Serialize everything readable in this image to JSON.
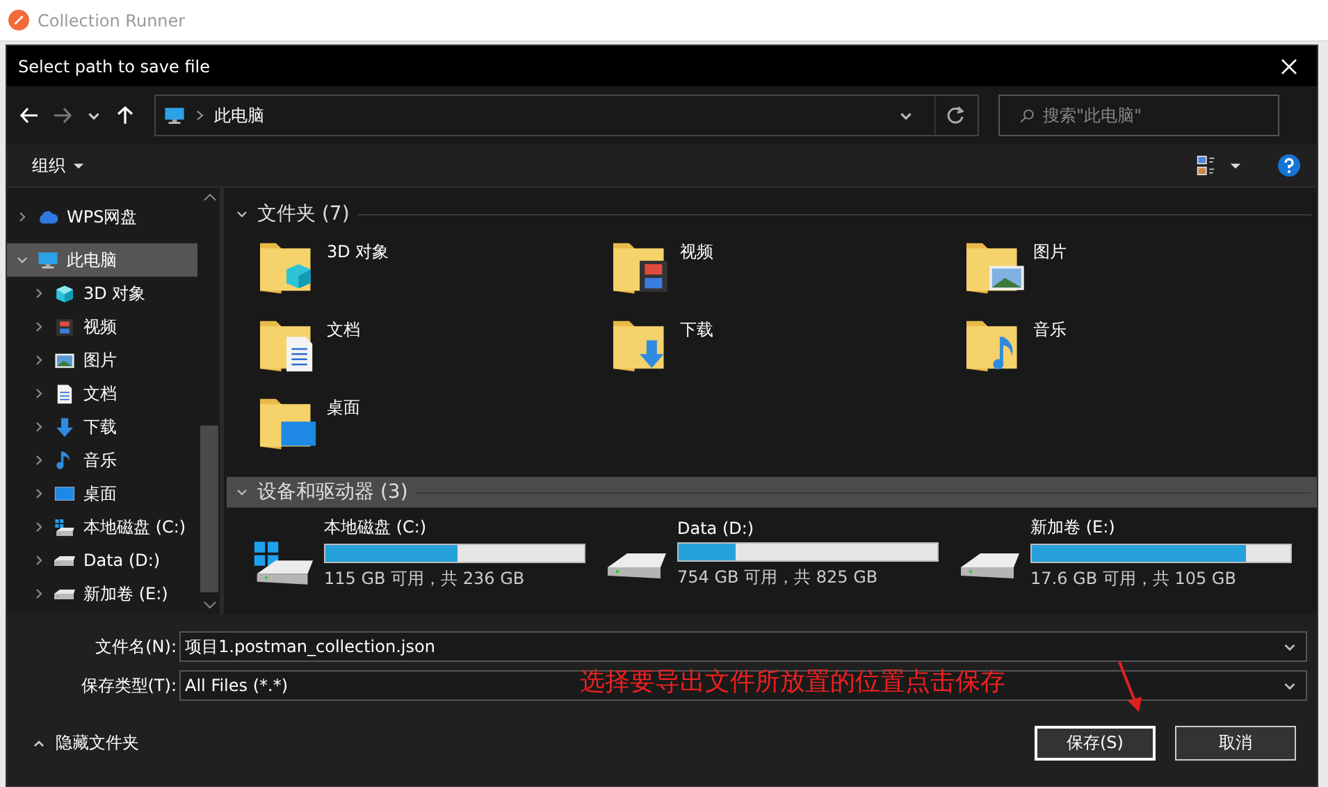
{
  "app": {
    "title": "Collection Runner"
  },
  "dialog": {
    "title": "Select path to save file",
    "address": {
      "crumb": "此电脑"
    },
    "search": {
      "placeholder": "搜索\"此电脑\""
    },
    "toolbar": {
      "organize": "组织"
    },
    "sidebar": {
      "items": [
        {
          "label": "WPS网盘",
          "kind": "cloud",
          "expanded": false,
          "selected": false
        },
        {
          "label": "此电脑",
          "kind": "pc",
          "expanded": true,
          "selected": true,
          "children": [
            {
              "label": "3D 对象",
              "kind": "cube",
              "expanded": false,
              "selected": false
            },
            {
              "label": "视频",
              "kind": "video",
              "expanded": false,
              "selected": false
            },
            {
              "label": "图片",
              "kind": "picture",
              "expanded": false,
              "selected": false
            },
            {
              "label": "文档",
              "kind": "document",
              "expanded": false,
              "selected": false
            },
            {
              "label": "下载",
              "kind": "download",
              "expanded": false,
              "selected": false
            },
            {
              "label": "音乐",
              "kind": "music",
              "expanded": false,
              "selected": false
            },
            {
              "label": "桌面",
              "kind": "desktop",
              "expanded": false,
              "selected": false
            },
            {
              "label": "本地磁盘 (C:)",
              "kind": "sysdrive",
              "expanded": false,
              "selected": false
            },
            {
              "label": "Data (D:)",
              "kind": "drive",
              "expanded": false,
              "selected": false
            },
            {
              "label": "新加卷 (E:)",
              "kind": "drive",
              "expanded": false,
              "selected": false
            }
          ]
        }
      ]
    },
    "folders": {
      "header": "文件夹 (7)",
      "expanded": true,
      "selected": false,
      "items": [
        {
          "label": "3D 对象",
          "kind": "cube"
        },
        {
          "label": "视频",
          "kind": "video"
        },
        {
          "label": "图片",
          "kind": "picture"
        },
        {
          "label": "文档",
          "kind": "document"
        },
        {
          "label": "下载",
          "kind": "download"
        },
        {
          "label": "音乐",
          "kind": "music"
        },
        {
          "label": "桌面",
          "kind": "desktop"
        }
      ]
    },
    "drives": {
      "header": "设备和驱动器 (3)",
      "expanded": true,
      "selected": true,
      "items": [
        {
          "label": "本地磁盘 (C:)",
          "kind": "sysdrive",
          "level": 0.51,
          "space": "115 GB 可用，共 236 GB"
        },
        {
          "label": "Data (D:)",
          "kind": "drive",
          "level": 0.22,
          "space": "754 GB 可用，共 825 GB"
        },
        {
          "label": "新加卷 (E:)",
          "kind": "drive",
          "level": 0.83,
          "space": "17.6 GB 可用，共 105 GB"
        }
      ]
    },
    "filename": {
      "label": "文件名(N):",
      "value": "项目1.postman_collection.json"
    },
    "filetype": {
      "label": "保存类型(T):",
      "value": "All Files (*.*)"
    },
    "hide_folders": "隐藏文件夹",
    "buttons": [
      {
        "label": "保存(S)",
        "kind": "primary"
      },
      {
        "label": "取消",
        "kind": "normal"
      }
    ]
  },
  "annotation": {
    "text": "选择要导出文件所放置的位置点击保存"
  }
}
